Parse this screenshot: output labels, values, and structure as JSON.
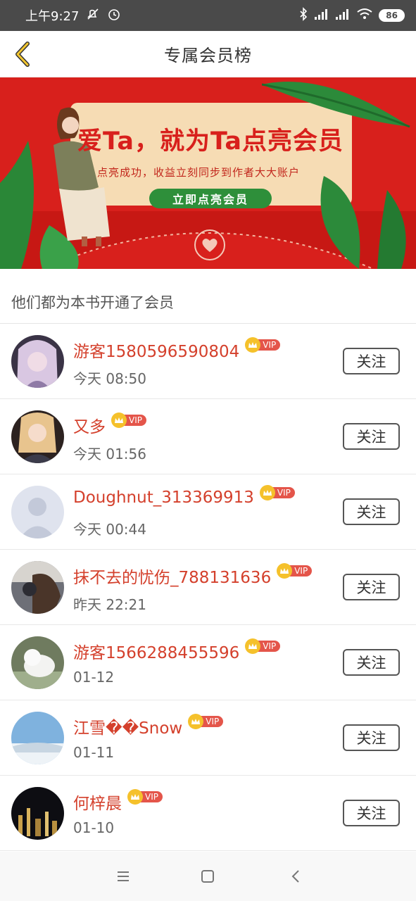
{
  "status_bar": {
    "time": "上午9:27",
    "battery": "86",
    "icons": [
      "mute-icon",
      "alarm-icon",
      "bluetooth-icon",
      "signal-icon",
      "signal-icon",
      "wifi-icon",
      "battery-icon"
    ]
  },
  "header": {
    "title": "专属会员榜",
    "back_icon": "chevron-left-icon"
  },
  "banner": {
    "headline": "爱Ta，就为Ta点亮会员",
    "subline": "点亮成功，收益立刻同步到作者大大账户",
    "cta_label": "立即点亮会员"
  },
  "section": {
    "title": "他们都为本书开通了会员"
  },
  "vip_label": "VIP",
  "follow_label": "关注",
  "members": [
    {
      "name": "游客1580596590804",
      "time": "今天 08:50"
    },
    {
      "name": "又多",
      "time": "今天 01:56"
    },
    {
      "name": "Doughnut_313369913",
      "time": "今天 00:44"
    },
    {
      "name": "抹不去的忧伤_788131636",
      "time": "昨天 22:21"
    },
    {
      "name": "游客1566288455596",
      "time": "01-12"
    },
    {
      "name": "江雪��Snow",
      "time": "01-11"
    },
    {
      "name": "何梓晨",
      "time": "01-10"
    }
  ],
  "colors": {
    "accent_red": "#d4402c",
    "banner_red": "#d8201c",
    "vip_gold": "#f5c12b",
    "status_bar": "#4a4a4a"
  }
}
